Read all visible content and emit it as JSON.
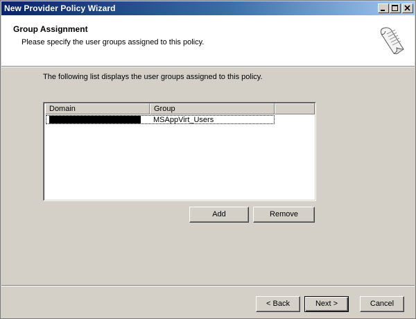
{
  "window": {
    "title": "New Provider Policy Wizard"
  },
  "header": {
    "title": "Group Assignment",
    "subtitle": "Please specify the user groups assigned to this policy."
  },
  "main": {
    "intro": "The following list displays the user groups assigned to this policy.",
    "list": {
      "columns": [
        "Domain",
        "Group"
      ],
      "rows": [
        {
          "domain": "[redacted]",
          "group": "MSAppVirt_Users"
        }
      ]
    },
    "add_label": "Add",
    "remove_label": "Remove"
  },
  "footer": {
    "back_label": "< Back",
    "next_label": "Next >",
    "cancel_label": "Cancel"
  },
  "icons": {
    "header": "scroll-document-icon",
    "minimize": "minimize-icon",
    "maximize": "maximize-icon",
    "close": "close-icon"
  },
  "colors": {
    "titlebar_start": "#0a246a",
    "titlebar_end": "#a6caf0",
    "face": "#d4d0c8"
  }
}
